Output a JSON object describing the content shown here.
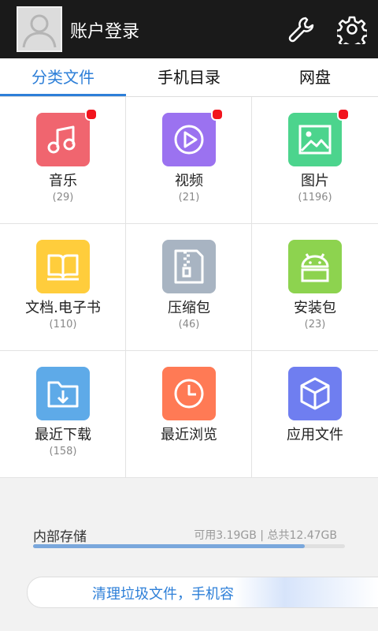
{
  "header": {
    "login_label": "账户登录",
    "avatar_icon": "default-user-avatar",
    "tools_icon": "wrench-icon",
    "settings_icon": "gear-icon"
  },
  "tabs": [
    {
      "label": "分类文件",
      "active": true
    },
    {
      "label": "手机目录",
      "active": false
    },
    {
      "label": "网盘",
      "active": false
    }
  ],
  "categories": [
    {
      "label": "音乐",
      "count": "(29)",
      "icon": "music-icon",
      "color": "#f0656f",
      "badge": true
    },
    {
      "label": "视频",
      "count": "(21)",
      "icon": "play-icon",
      "color": "#9b72f0",
      "badge": true
    },
    {
      "label": "图片",
      "count": "(1196)",
      "icon": "image-icon",
      "color": "#4cd48d",
      "badge": true
    },
    {
      "label": "文档.电子书",
      "count": "(110)",
      "icon": "book-icon",
      "color": "#ffcd3c",
      "badge": false
    },
    {
      "label": "压缩包",
      "count": "(46)",
      "icon": "zip-icon",
      "color": "#a8b4c2",
      "badge": false
    },
    {
      "label": "安装包",
      "count": "(23)",
      "icon": "android-icon",
      "color": "#8dd34f",
      "badge": false
    },
    {
      "label": "最近下载",
      "count": "(158)",
      "icon": "download-folder-icon",
      "color": "#5eaae8",
      "badge": false
    },
    {
      "label": "最近浏览",
      "count": "",
      "icon": "clock-icon",
      "color": "#ff7a55",
      "badge": false
    },
    {
      "label": "应用文件",
      "count": "",
      "icon": "cube-icon",
      "color": "#6f7ef0",
      "badge": false
    }
  ],
  "storage": {
    "label": "内部存储",
    "info": "可用3.19GB | 总共12.47GB",
    "used_fraction": 0.87
  },
  "clean_button": {
    "label": "清理垃圾文件，手机容"
  },
  "colors": {
    "accent": "#2d7fd8",
    "badge": "#f2141d",
    "header_bg": "#1a1a1a"
  }
}
